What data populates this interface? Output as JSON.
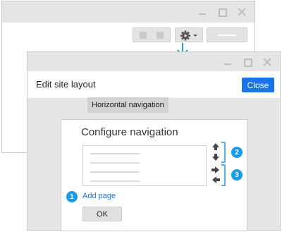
{
  "back_window": {
    "controls": [
      "minimize",
      "maximize",
      "close"
    ]
  },
  "dialog": {
    "title": "Edit site layout",
    "close_label": "Close",
    "tab_label": "Horizontal navigation",
    "configure": {
      "title": "Configure navigation",
      "add_page_label": "Add page",
      "ok_label": "OK"
    },
    "callouts": [
      "1",
      "2",
      "3"
    ]
  },
  "colors": {
    "accent": "#1a73e8",
    "callout": "#1b9ce6",
    "titlebar": "#e5e5e5",
    "panel_bg": "#e6e6e6"
  },
  "icons": [
    "gear-icon",
    "chevron-down-icon",
    "arrow-down-icon",
    "arrow-up-icon",
    "arrow-right-icon",
    "arrow-left-icon"
  ]
}
